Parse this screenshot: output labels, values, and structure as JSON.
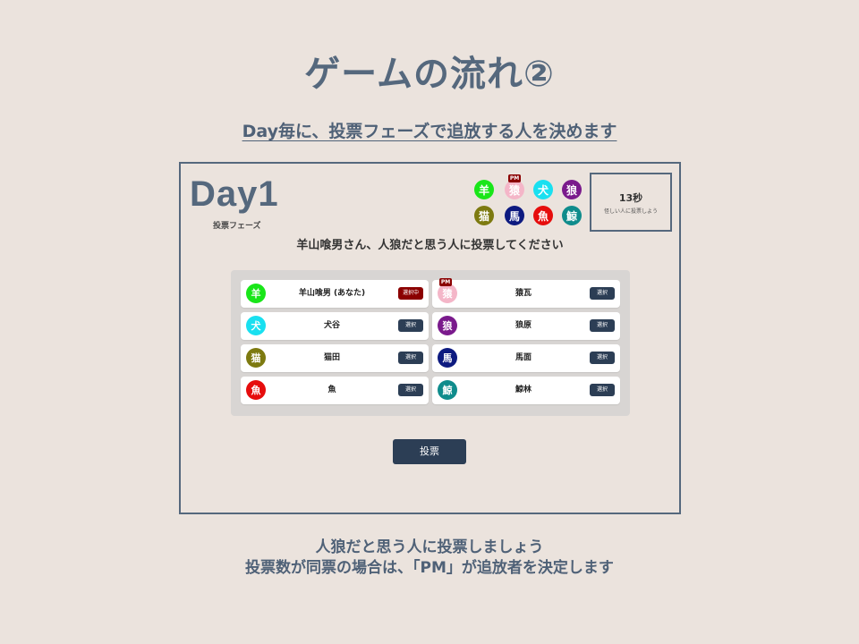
{
  "slide": {
    "title": "ゲームの流れ②",
    "subtitle": "Day毎に、投票フェーズで追放する人を決めます",
    "footer_line1": "人狼だと思う人に投票しましょう",
    "footer_line2": "投票数が同票の場合は、「PM」が追放者を決定します"
  },
  "game": {
    "day_title": "Day1",
    "phase": "投票フェーズ",
    "timer": "13秒",
    "timer_hint": "怪しい人に投票しよう",
    "instruction": "羊山喰男さん、人狼だと思う人に投票してください",
    "pm_label": "PM",
    "vote_button": "投票",
    "chips": [
      {
        "glyph": "羊",
        "color": "#19e619"
      },
      {
        "glyph": "猿",
        "color": "#f4b6c8",
        "pm": true
      },
      {
        "glyph": "犬",
        "color": "#19e0f0"
      },
      {
        "glyph": "狼",
        "color": "#7a1a8c"
      },
      {
        "glyph": "猫",
        "color": "#7d7a10"
      },
      {
        "glyph": "馬",
        "color": "#0d1a80"
      },
      {
        "glyph": "魚",
        "color": "#e60d0d"
      },
      {
        "glyph": "鯨",
        "color": "#0f8c8c"
      }
    ],
    "players": [
      {
        "glyph": "羊",
        "color": "#19e619",
        "name": "羊山喰男 (あなた)",
        "button": "選択中",
        "active": true
      },
      {
        "glyph": "猿",
        "color": "#f4b6c8",
        "name": "猿瓦",
        "button": "選択",
        "pm": true
      },
      {
        "glyph": "犬",
        "color": "#19e0f0",
        "name": "犬谷",
        "button": "選択"
      },
      {
        "glyph": "狼",
        "color": "#7a1a8c",
        "name": "狼原",
        "button": "選択"
      },
      {
        "glyph": "猫",
        "color": "#7d7a10",
        "name": "猫田",
        "button": "選択"
      },
      {
        "glyph": "馬",
        "color": "#0d1a80",
        "name": "馬面",
        "button": "選択"
      },
      {
        "glyph": "魚",
        "color": "#e60d0d",
        "name": "魚",
        "button": "選択"
      },
      {
        "glyph": "鯨",
        "color": "#0f8c8c",
        "name": "鯨林",
        "button": "選択"
      }
    ]
  },
  "colors": {
    "background": "#ebe3dd",
    "text": "#4f6177",
    "button": "#2c3e55",
    "selected_button": "#8b0000"
  }
}
